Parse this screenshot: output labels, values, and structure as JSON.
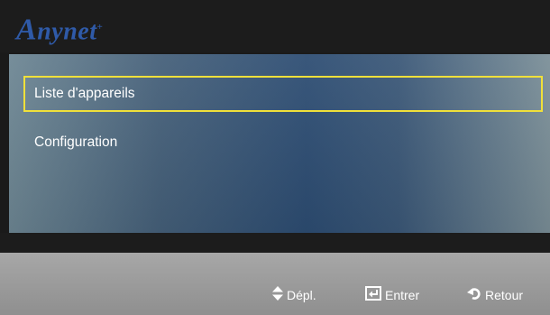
{
  "header": {
    "logo_text": "nynet",
    "logo_mark": "A",
    "logo_reg": "+"
  },
  "menu": {
    "items": [
      {
        "label": "Liste d'appareils",
        "selected": true
      },
      {
        "label": "Configuration",
        "selected": false
      }
    ]
  },
  "footer": {
    "move_label": "Dépl.",
    "enter_label": "Entrer",
    "back_label": "Retour",
    "move_icon": "up-down-arrows-icon",
    "enter_icon": "enter-icon",
    "back_icon": "return-icon"
  },
  "colors": {
    "selection_border": "#f0e03a",
    "logo": "#2f5aa8"
  }
}
